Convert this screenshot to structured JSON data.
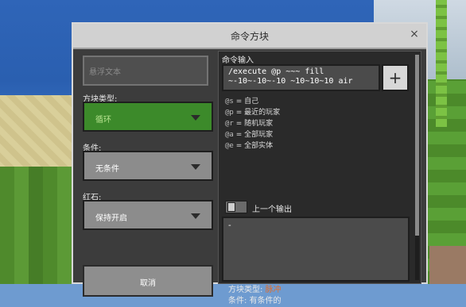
{
  "dialog": {
    "title": "命令方块",
    "close_symbol": "×"
  },
  "left_panel": {
    "custom_name_placeholder": "悬浮文本",
    "block_type": {
      "label": "方块类型:",
      "selected": "循环"
    },
    "condition": {
      "label": "条件:",
      "selected": "无条件"
    },
    "redstone": {
      "label": "红石:",
      "selected": "保持开启"
    },
    "cancel_label": "取消"
  },
  "right_panel": {
    "command_input_label": "命令输入",
    "command_line_1": "/execute @p ~~~ fill",
    "command_line_2": "~-10~-10~-10 ~10~10~10 air",
    "plus_symbol": "+",
    "selectors": [
      {
        "code": "@s",
        "desc": "自己"
      },
      {
        "code": "@p",
        "desc": "最近的玩家"
      },
      {
        "code": "@r",
        "desc": "随机玩家"
      },
      {
        "code": "@a",
        "desc": "全部玩家"
      },
      {
        "code": "@e",
        "desc": "全部实体"
      }
    ],
    "previous_output_label": "上一个输出",
    "output_text": "-",
    "info_block_type_label": "方块类型:",
    "info_block_type_value": "脉冲",
    "info_condition_text": "条件: 有条件的"
  },
  "colors": {
    "accent_orange": "#e06e2c",
    "selected_green": "#3c8a2a"
  }
}
